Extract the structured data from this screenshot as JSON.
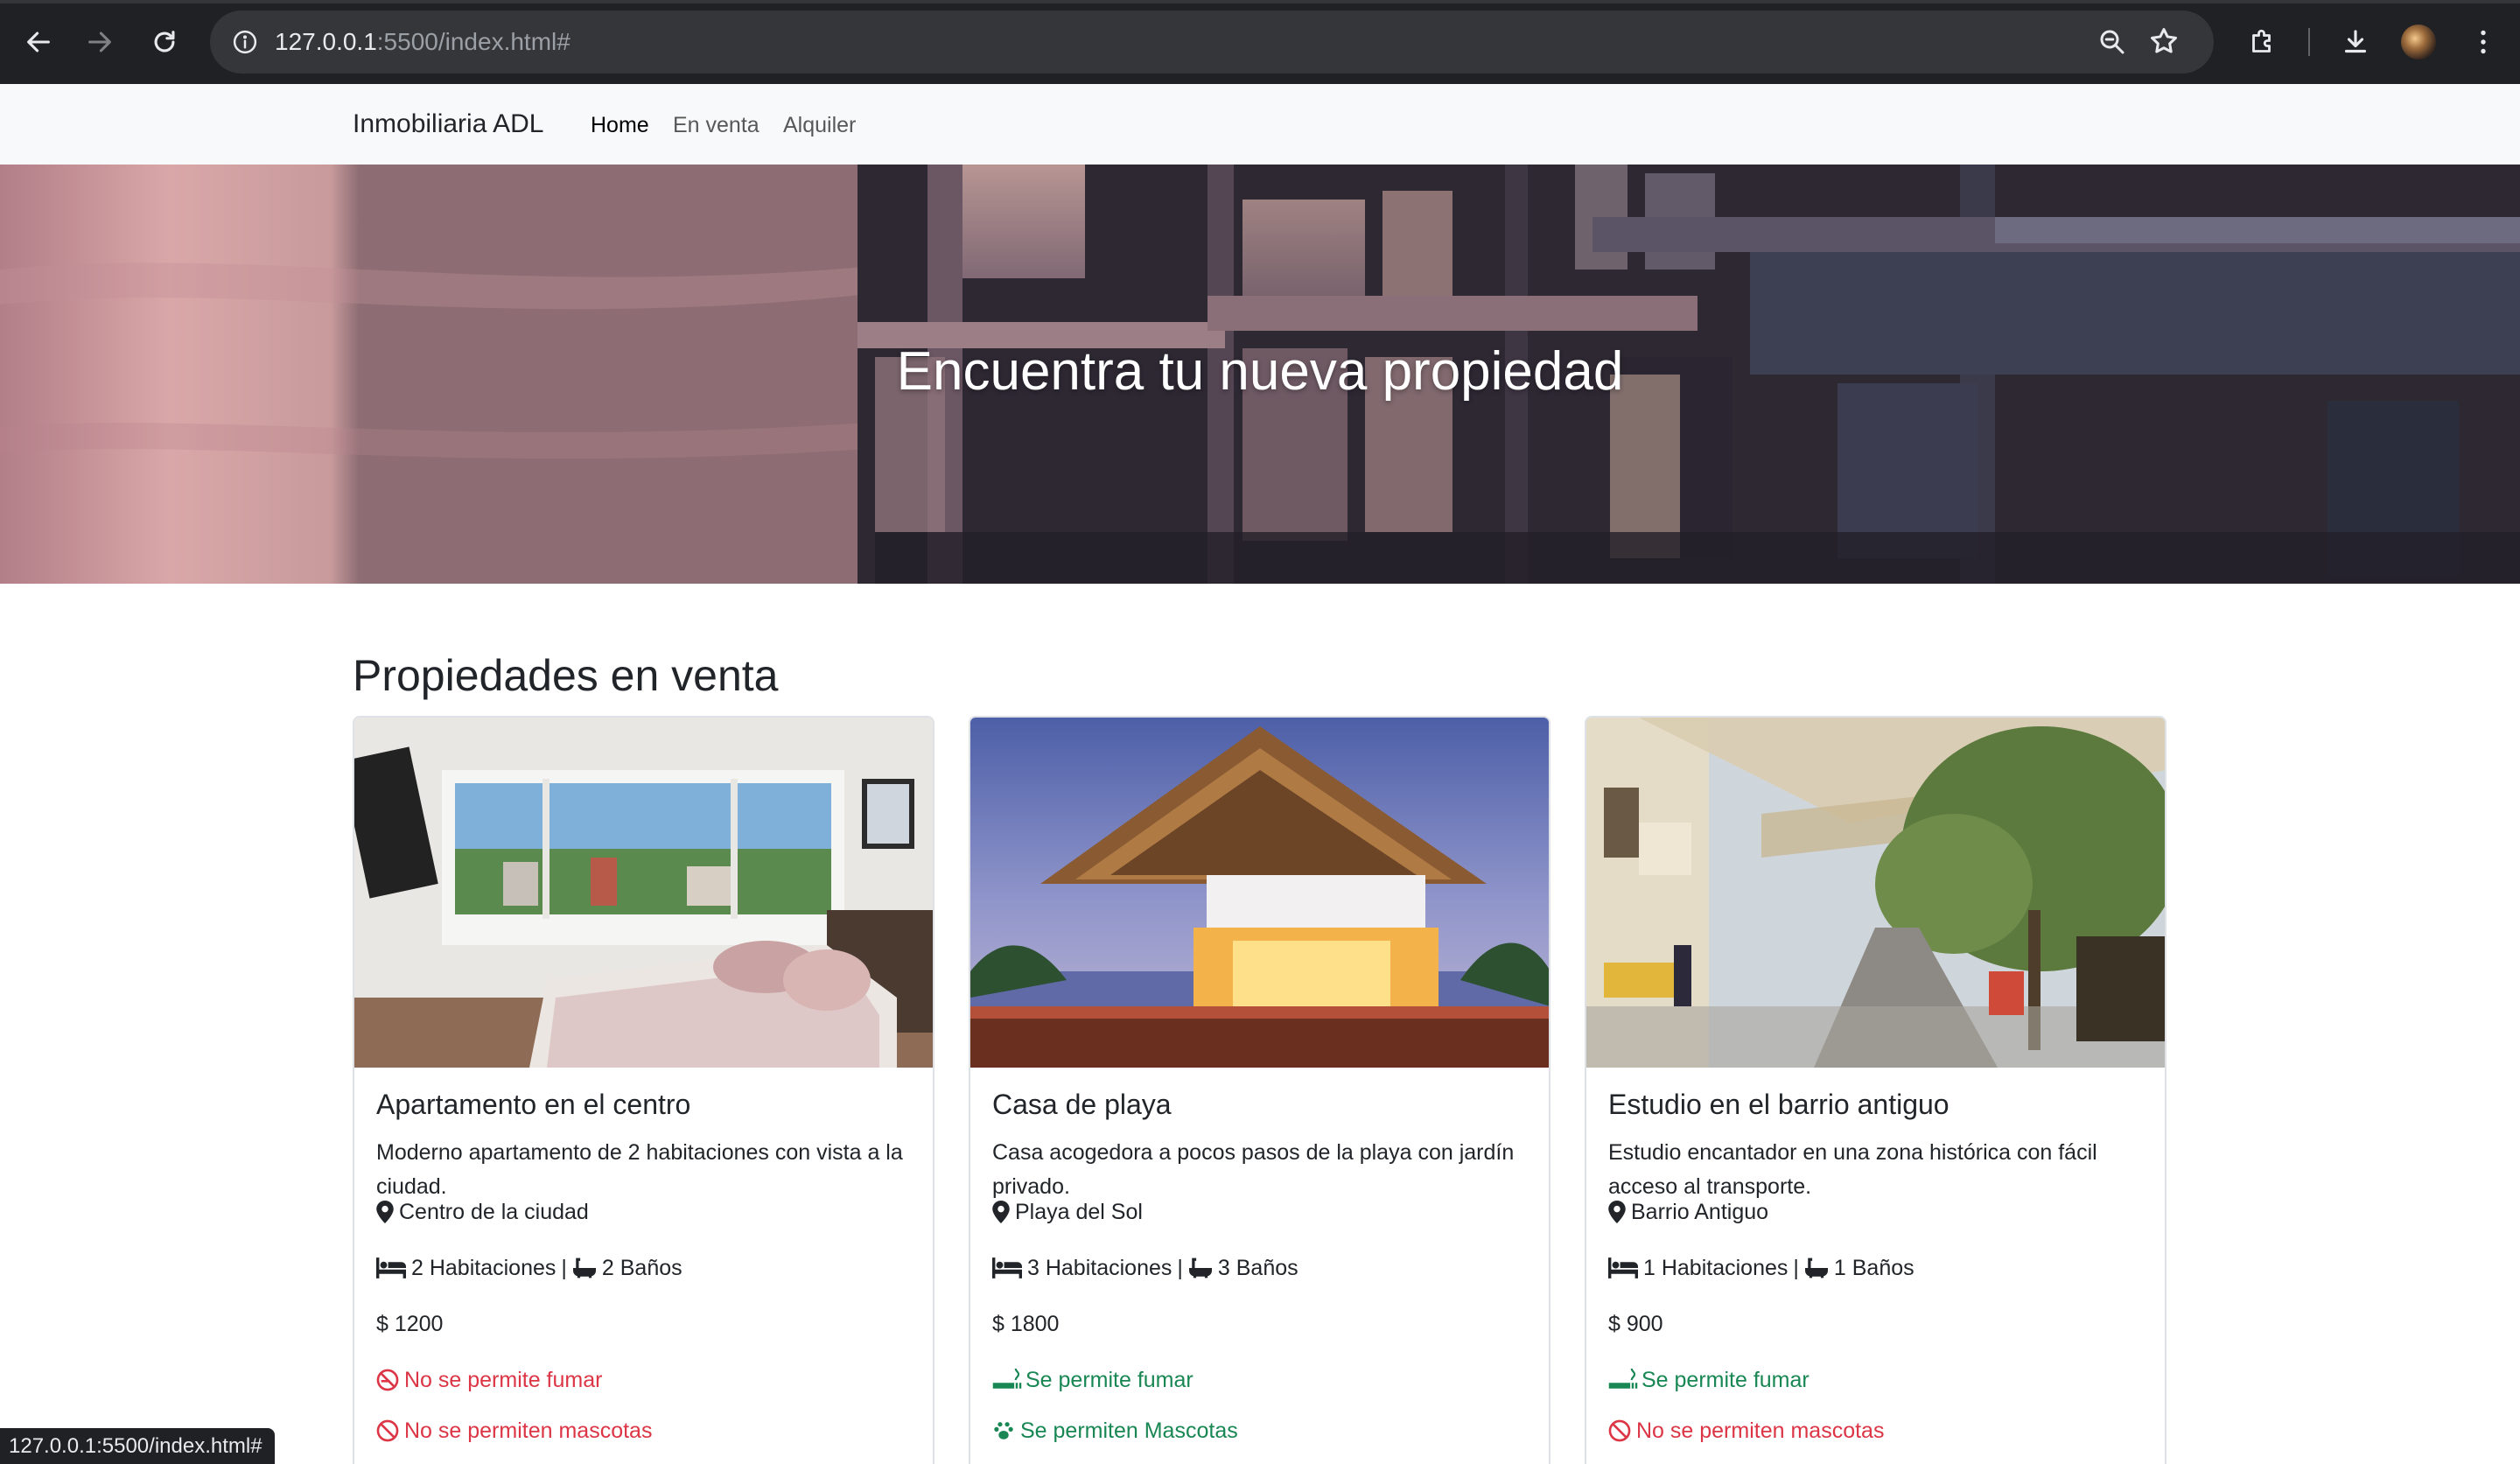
{
  "browser": {
    "url_host": "127.0.0.1",
    "url_rest": ":5500/index.html#",
    "status_url": "127.0.0.1:5500/index.html#"
  },
  "navbar": {
    "brand": "Inmobiliaria ADL",
    "links": [
      {
        "label": "Home",
        "active": true
      },
      {
        "label": "En venta",
        "active": false
      },
      {
        "label": "Alquiler",
        "active": false
      }
    ]
  },
  "hero": {
    "title": "Encuentra tu nueva propiedad"
  },
  "section": {
    "title": "Propiedades en venta"
  },
  "properties": [
    {
      "title": "Apartamento en el centro",
      "description": "Moderno apartamento de 2 habitaciones con vista a la ciudad.",
      "location": "Centro de la ciudad",
      "rooms": "2 Habitaciones",
      "separator": "|",
      "baths": "2 Baños",
      "price": "$ 1200",
      "smoking": "No se permite fumar",
      "smoking_allowed": false,
      "pets": "No se permiten mascotas",
      "pets_allowed": false
    },
    {
      "title": "Casa de playa",
      "description": "Casa acogedora a pocos pasos de la playa con jardín privado.",
      "location": "Playa del Sol",
      "rooms": "3 Habitaciones",
      "separator": "|",
      "baths": "3 Baños",
      "price": "$ 1800",
      "smoking": "Se permite fumar",
      "smoking_allowed": true,
      "pets": "Se permiten Mascotas",
      "pets_allowed": true
    },
    {
      "title": "Estudio en el barrio antiguo",
      "description": "Estudio encantador en una zona histórica con fácil acceso al transporte.",
      "location": "Barrio Antiguo",
      "rooms": "1 Habitaciones",
      "separator": "|",
      "baths": "1 Baños",
      "price": "$ 900",
      "smoking": "Se permite fumar",
      "smoking_allowed": true,
      "pets": "No se permiten mascotas",
      "pets_allowed": false
    }
  ],
  "colors": {
    "not_allowed": "#dc3545",
    "allowed": "#198754",
    "navbar_bg": "#f8f9fa"
  }
}
